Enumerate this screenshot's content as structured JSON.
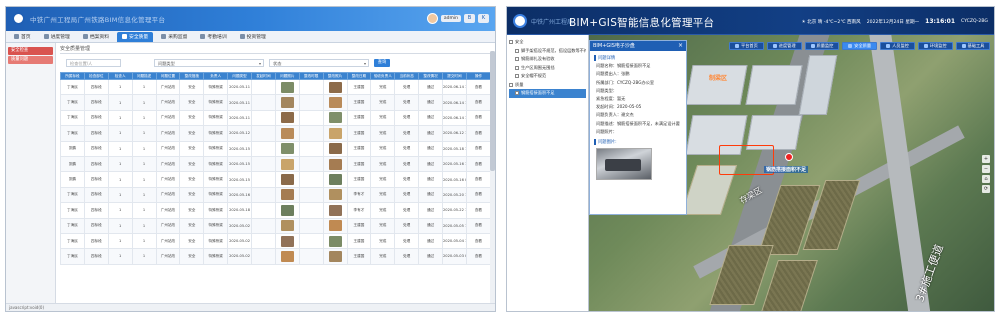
{
  "left": {
    "window_title": "中铁广州工程局广州铁路BIM信息化管理平台",
    "user": {
      "name": "admin",
      "badge_b": "B",
      "badge_k": "K"
    },
    "nav": [
      {
        "label": "首页",
        "active": false,
        "icon": "home-icon"
      },
      {
        "label": "进度管理",
        "active": false,
        "icon": "schedule-icon"
      },
      {
        "label": "档案资料",
        "active": false,
        "icon": "archive-icon"
      },
      {
        "label": "安全质量",
        "active": true,
        "icon": "shield-icon"
      },
      {
        "label": "采购监督",
        "active": false,
        "icon": "purchase-icon"
      },
      {
        "label": "考勤培训",
        "active": false,
        "icon": "training-icon"
      },
      {
        "label": "投资管理",
        "active": false,
        "icon": "invest-icon"
      }
    ],
    "side": [
      {
        "label": "安全检查",
        "active": true
      },
      {
        "label": "质量问题",
        "active": false
      }
    ],
    "breadcrumb": "安全质量管理",
    "filters": {
      "search_placeholder": "检查位置/人",
      "select1": "问题类型",
      "select2": "状态",
      "button": "查询"
    },
    "columns": [
      "所属标段",
      "检查部位",
      "检查人",
      "问题描述",
      "问题位置",
      "整改措施",
      "负责人",
      "问题类型",
      "发起时间",
      "问题照片",
      "整改时限",
      "整改照片",
      "整改日期",
      "验收负责人",
      "当前状态",
      "整改情况",
      "提交时间",
      "操作"
    ],
    "rows": [
      [
        "丁海民",
        "四标段",
        "1",
        "1",
        "广州站改",
        "安全",
        "特殊桥梁",
        "2020-05-11",
        "",
        "2020-06-14",
        "",
        "2020-06-14",
        "王建国",
        "完成",
        "处理",
        "通过",
        "2020-06-14 15:26",
        "查看"
      ],
      [
        "丁海民",
        "四标段",
        "1",
        "1",
        "广州站改",
        "安全",
        "特殊桥梁",
        "2020-05-11",
        "",
        "2020-06-14",
        "",
        "2020-06-14",
        "王建国",
        "完成",
        "处理",
        "通过",
        "2020-06-14 15:26",
        "查看"
      ],
      [
        "丁海民",
        "四标段",
        "1",
        "1",
        "广州站改",
        "安全",
        "特殊桥梁",
        "2020-05-11",
        "",
        "2020-06-14",
        "",
        "2020-06-14",
        "王建国",
        "完成",
        "处理",
        "通过",
        "2020-06-14 15:26",
        "查看"
      ],
      [
        "丁海民",
        "四标段",
        "1",
        "1",
        "广州站改",
        "安全",
        "特殊桥梁",
        "2020-05-12",
        "",
        "2020-06-12",
        "",
        "2020-06-12",
        "王建国",
        "完成",
        "处理",
        "通过",
        "2020-06-12 10:18",
        "查看"
      ],
      [
        "张鹏",
        "四标段",
        "1",
        "1",
        "广州站改",
        "安全",
        "特殊桥梁",
        "2020-05-15",
        "",
        "2020-05-18",
        "",
        "2020-05-18",
        "王建国",
        "完成",
        "处理",
        "通过",
        "2020-05-18 16:02",
        "查看"
      ],
      [
        "张鹏",
        "四标段",
        "1",
        "1",
        "广州站改",
        "安全",
        "特殊桥梁",
        "2020-05-15",
        "",
        "2020-05-16",
        "",
        "2020-05-16",
        "王建国",
        "完成",
        "处理",
        "通过",
        "2020-05-16 10:25",
        "查看"
      ],
      [
        "张鹏",
        "四标段",
        "1",
        "1",
        "广州站改",
        "安全",
        "特殊桥梁",
        "2020-05-15",
        "",
        "2020-05-16",
        "",
        "2020-05-16",
        "王建国",
        "完成",
        "处理",
        "通过",
        "2020-05-16 09:41",
        "查看"
      ],
      [
        "丁海民",
        "四标段",
        "1",
        "1",
        "广州站改",
        "安全",
        "特殊桥梁",
        "2020-05-16",
        "",
        "2020-05-20",
        "",
        "2020-05-20",
        "李有才",
        "完成",
        "处理",
        "通过",
        "2020-05-20 11:32",
        "查看"
      ],
      [
        "丁海民",
        "四标段",
        "1",
        "1",
        "广州站改",
        "安全",
        "特殊桥梁",
        "2020-05-18",
        "",
        "2020-05-22",
        "",
        "2020-05-22",
        "李有才",
        "完成",
        "处理",
        "通过",
        "2020-05-22 14:06",
        "查看"
      ],
      [
        "丁海民",
        "四标段",
        "1",
        "1",
        "广州站改",
        "安全",
        "特殊桥梁",
        "2020-05-02",
        "",
        "2020-05-05",
        "",
        "2020-05-05",
        "王建国",
        "完成",
        "处理",
        "通过",
        "2020-05-05 10:20",
        "查看"
      ],
      [
        "丁海民",
        "四标段",
        "1",
        "1",
        "广州站改",
        "安全",
        "特殊桥梁",
        "2020-05-02",
        "",
        "2020-05-04",
        "",
        "2020-05-04",
        "王建国",
        "完成",
        "处理",
        "通过",
        "2020-05-04 16:47",
        "查看"
      ],
      [
        "丁海民",
        "四标段",
        "1",
        "1",
        "广州站改",
        "安全",
        "特殊桥梁",
        "2020-05-02",
        "",
        "2020-05-03",
        "",
        "2020-05-03",
        "王建国",
        "完成",
        "处理",
        "通过",
        "2020-05-03 09:02",
        "查看"
      ]
    ],
    "thumb_colors": [
      "#b98b5a",
      "#7f8f6a",
      "#c9a46a",
      "#8a6a4a",
      "#a57c52",
      "#6d7f5e",
      "#b0905f",
      "#917258",
      "#c08a52",
      "#7c8c66",
      "#a3865e",
      "#8d6b49"
    ],
    "status_bar": "javascript:void(0)"
  },
  "right": {
    "org_name": "中铁广州工程局",
    "title": "BIM+GIS智能信息化管理平台",
    "weather": "☀ 北京  晴 -4℃~2℃  西南风",
    "date": "2022年12月24日  星期一",
    "time": "13:16:01",
    "station": "CYCZQ-2BG",
    "tree": [
      {
        "label": "安全",
        "level": 0,
        "selected": false
      },
      {
        "label": "脚手架搭设不规范，搭设层数等不符合",
        "level": 1,
        "selected": false
      },
      {
        "label": "钢筋绑扎没有验收",
        "level": 1,
        "selected": false
      },
      {
        "label": "生产区周围无围挡",
        "level": 1,
        "selected": false
      },
      {
        "label": "安全帽不规范",
        "level": 1,
        "selected": false
      },
      {
        "label": "质量",
        "level": 0,
        "selected": false
      },
      {
        "label": "钢筋搭接面积不足",
        "level": 1,
        "selected": true
      }
    ],
    "popup_header": "BIM+GIS电子沙盘",
    "popup_close": "×",
    "popup_section1": "问题详情",
    "popup_section2": "问题图片:",
    "popup_rows": [
      "问题名称：钢筋搭接面积不足",
      "问题提出人：张鹏",
      "所属部门：CYCZQ-2BG办公室",
      "问题类型：",
      "紧急程度：暂无",
      "发起时间：2020-05-05",
      "问题负责人：谢文杰",
      "问题描述：钢筋搭接面积不足，未满足设计要求",
      "问题照片："
    ],
    "tabs": [
      {
        "label": "平台首页",
        "active": false
      },
      {
        "label": "进度管理",
        "active": false
      },
      {
        "label": "质量监控",
        "active": false
      },
      {
        "label": "安全质量",
        "active": true
      },
      {
        "label": "人员监控",
        "active": false
      },
      {
        "label": "环境监控",
        "active": false
      },
      {
        "label": "基础工具",
        "active": false
      }
    ],
    "map_labels": {
      "zone_a": "存梁区",
      "zone_b": "制梁区",
      "road": "3#施工便道",
      "marker": "钢筋搭接面积不足"
    },
    "controls": [
      "+",
      "−",
      "⌂",
      "⟳"
    ]
  }
}
